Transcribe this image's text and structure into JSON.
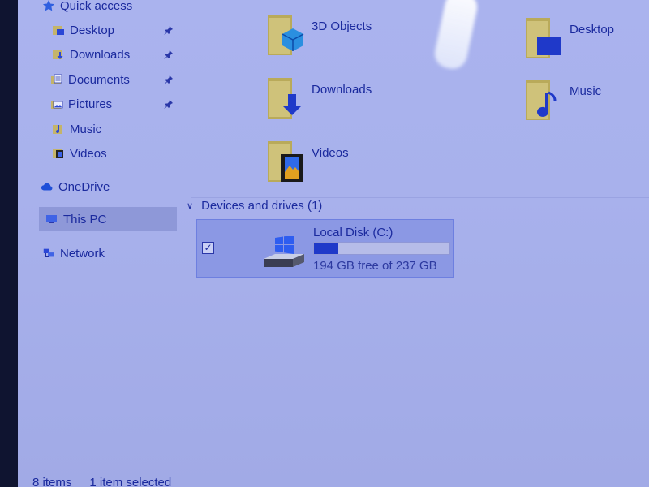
{
  "sidebar": {
    "items": [
      {
        "label": "Quick access",
        "icon": "star-icon"
      },
      {
        "label": "Desktop",
        "icon": "desktop-folder-icon",
        "pinned": true
      },
      {
        "label": "Downloads",
        "icon": "downloads-folder-icon",
        "pinned": true
      },
      {
        "label": "Documents",
        "icon": "documents-folder-icon",
        "pinned": true
      },
      {
        "label": "Pictures",
        "icon": "pictures-folder-icon",
        "pinned": true
      },
      {
        "label": "Music",
        "icon": "music-folder-icon"
      },
      {
        "label": "Videos",
        "icon": "videos-folder-icon"
      },
      {
        "label": "OneDrive",
        "icon": "cloud-icon"
      },
      {
        "label": "This PC",
        "icon": "computer-icon",
        "selected": true
      },
      {
        "label": "Network",
        "icon": "network-icon"
      }
    ]
  },
  "folders": [
    {
      "label": "3D Objects",
      "icon": "3d-objects-folder-icon"
    },
    {
      "label": "Desktop",
      "icon": "desktop-folder-icon"
    },
    {
      "label": "Downloads",
      "icon": "downloads-folder-icon"
    },
    {
      "label": "Music",
      "icon": "music-folder-icon"
    },
    {
      "label": "Videos",
      "icon": "videos-folder-icon"
    }
  ],
  "devices": {
    "header": "Devices and drives (1)",
    "drives": [
      {
        "name": "Local Disk (C:)",
        "free_text": "194 GB free of 237 GB",
        "used_fraction": 0.18,
        "checked": true
      }
    ]
  },
  "status": {
    "items_count": "8 items",
    "selection": "1 item selected"
  },
  "colors": {
    "accent": "#1b2a9e",
    "selection": "#8b98e4",
    "bar_fill": "#1f39c9"
  }
}
